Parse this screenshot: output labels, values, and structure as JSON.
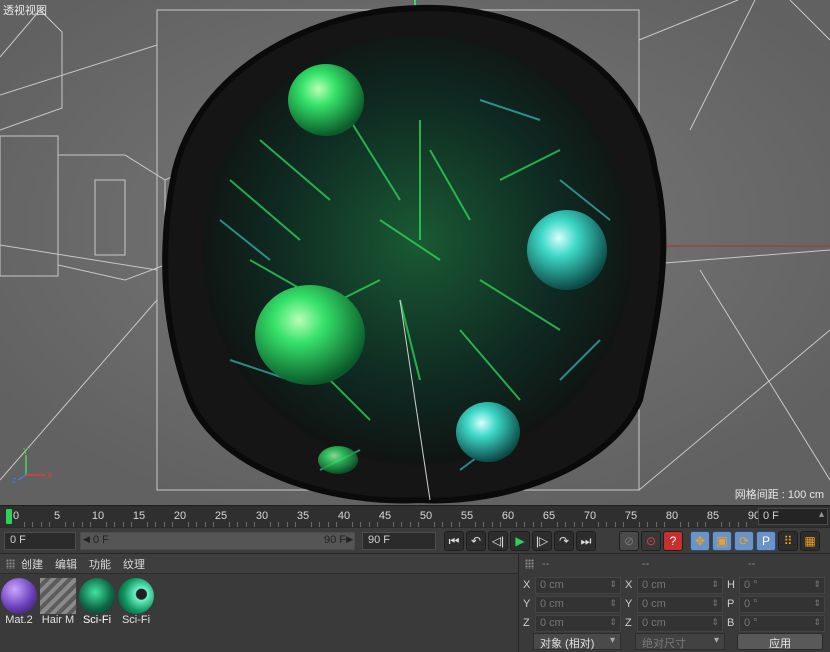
{
  "viewport": {
    "label": "透视视图",
    "grid_spacing": "网格间距 : 100 cm",
    "axis": {
      "x": "X",
      "y": "Y",
      "z": "Z"
    },
    "colors": {
      "background": "#6e6e6e",
      "fur_dark": "#111111",
      "fur_green": "#2ee85c",
      "fur_cyan": "#3fd6d0"
    }
  },
  "timeline": {
    "ticks": [
      "0",
      "5",
      "10",
      "15",
      "20",
      "25",
      "30",
      "35",
      "40",
      "45",
      "50",
      "55",
      "60",
      "65",
      "70",
      "75",
      "80",
      "85",
      "90"
    ],
    "current_frame_display": "0 F",
    "playhead_color": "#2fd05a"
  },
  "transport": {
    "start_frame": "0 F",
    "range_start": "0 F",
    "range_end": "90 F",
    "end_frame": "90 F",
    "buttons": [
      {
        "name": "go-to-start-icon",
        "glyph": "⏮"
      },
      {
        "name": "prev-key-icon",
        "glyph": "↶"
      },
      {
        "name": "step-back-icon",
        "glyph": "◁|"
      },
      {
        "name": "play-icon",
        "glyph": "▶"
      },
      {
        "name": "step-forward-icon",
        "glyph": "|▷"
      },
      {
        "name": "next-key-icon",
        "glyph": "↷"
      },
      {
        "name": "go-to-end-icon",
        "glyph": "⏭"
      }
    ],
    "record_buttons": [
      {
        "name": "record-key-icon",
        "glyph": "⊘"
      },
      {
        "name": "auto-key-icon",
        "glyph": "⊙"
      },
      {
        "name": "key-help-icon",
        "glyph": "?"
      }
    ],
    "key_buttons": [
      {
        "name": "move-key-icon",
        "glyph": "✥"
      },
      {
        "name": "scale-key-icon",
        "glyph": "▣"
      },
      {
        "name": "rotate-key-icon",
        "glyph": "⟳"
      },
      {
        "name": "param-key-icon",
        "glyph": "P"
      },
      {
        "name": "point-level-icon",
        "glyph": "⠿"
      },
      {
        "name": "film-icon",
        "glyph": "▦"
      }
    ]
  },
  "materials": {
    "menu": [
      "创建",
      "编辑",
      "功能",
      "纹理"
    ],
    "items": [
      {
        "label": "Mat.2",
        "kind": "sphere-purple"
      },
      {
        "label": "Hair M",
        "kind": "hair-stripes"
      },
      {
        "label": "Sci-Fi",
        "kind": "fur-green"
      },
      {
        "label": "Sci-Fi",
        "kind": "fur-green-eye"
      }
    ]
  },
  "coordinates": {
    "headers": [
      "--",
      "--",
      "--"
    ],
    "rows": [
      {
        "axis": "X",
        "value": "0 cm"
      },
      {
        "axis": "Y",
        "value": "0 cm"
      },
      {
        "axis": "Z",
        "value": "0 cm"
      }
    ],
    "size_rows": [
      {
        "axis": "X",
        "value": "0 cm"
      },
      {
        "axis": "Y",
        "value": "0 cm"
      },
      {
        "axis": "Z",
        "value": "0 cm"
      }
    ],
    "rot_rows": [
      {
        "axis": "H",
        "value": "0 °"
      },
      {
        "axis": "P",
        "value": "0 °"
      },
      {
        "axis": "B",
        "value": "0 °"
      }
    ],
    "mode_select": "对象 (相对)",
    "size_select": "绝对尺寸",
    "apply": "应用"
  }
}
